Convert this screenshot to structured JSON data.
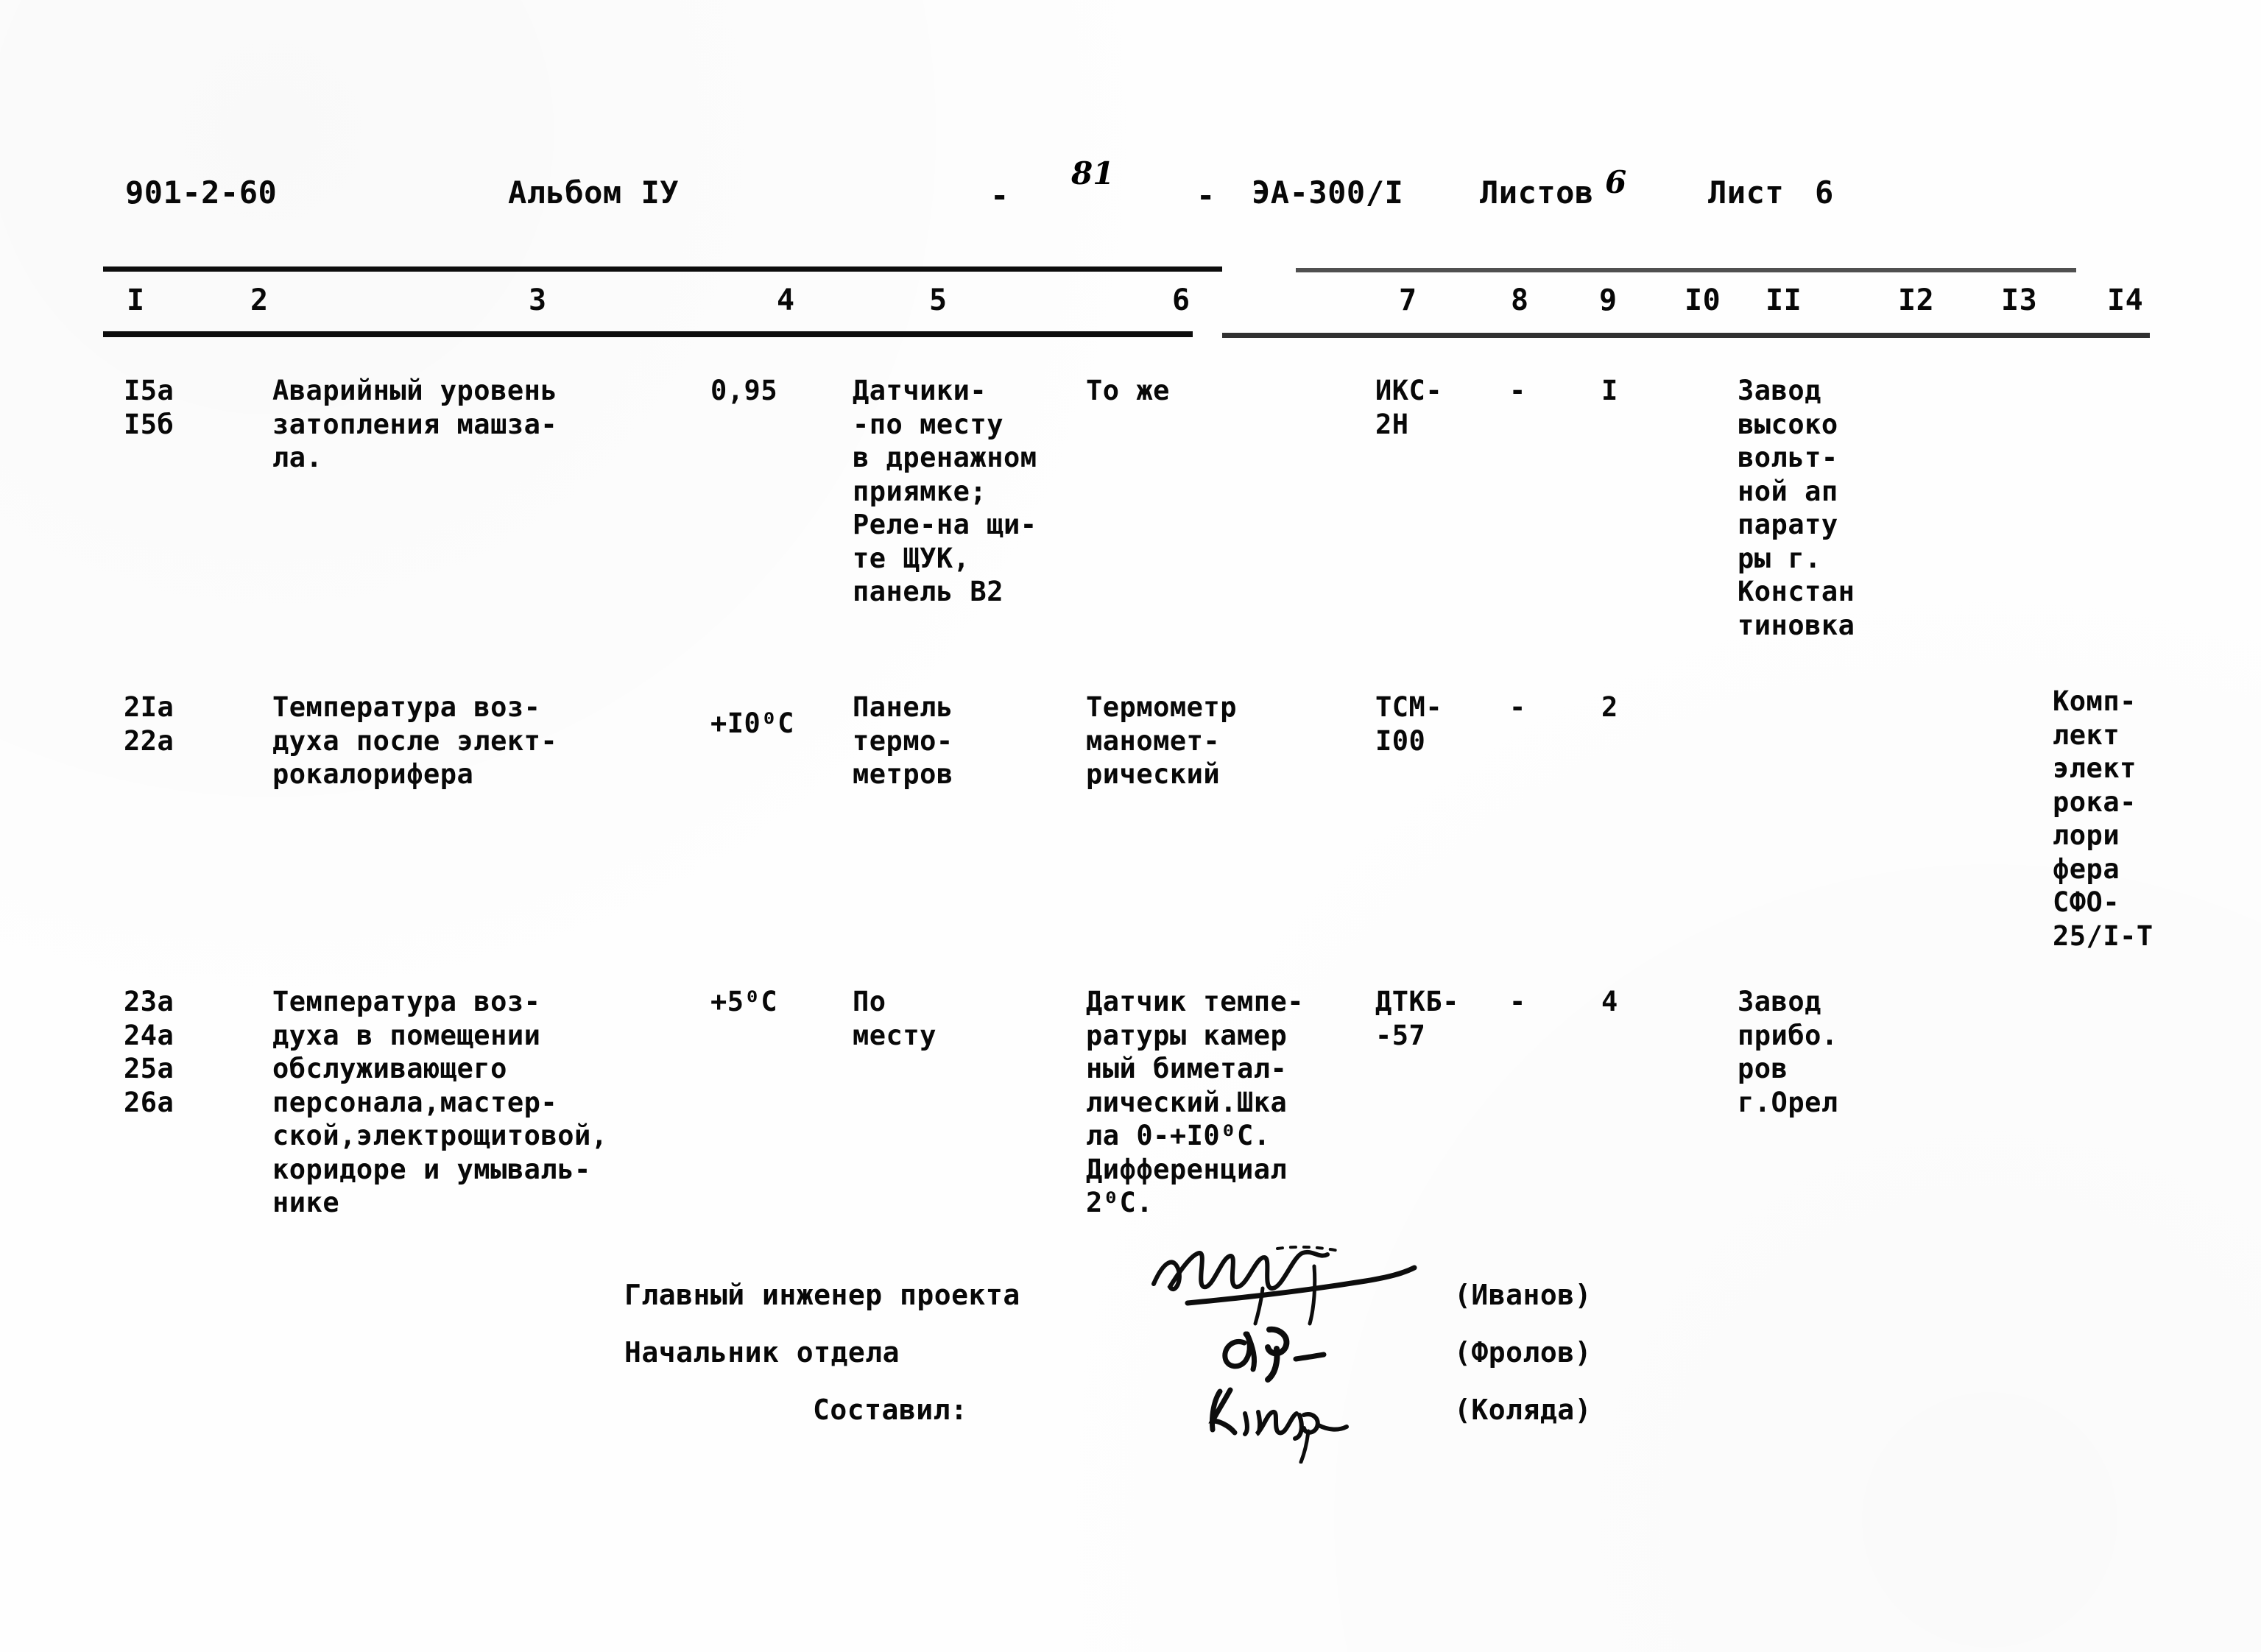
{
  "header": {
    "project_code": "901-2-60",
    "album": "Альбом IУ",
    "dash_left": "-",
    "page_number": "81",
    "dash_right": "-",
    "mark": "ЭА-300/I",
    "sheets_of_label": "Листов",
    "sheets_of_value": "6",
    "sheet_label": "Лист",
    "sheet_value": "6"
  },
  "table": {
    "column_numbers": [
      "I",
      "2",
      "3",
      "4",
      "5",
      "6",
      "7",
      "8",
      "9",
      "I0",
      "II",
      "I2",
      "I3",
      "I4"
    ],
    "rows": [
      {
        "col1": "I5а\nI5б",
        "col2": "Аварийный уровень\nзатопления машза-\nла.",
        "col4": "0,95",
        "col5": "Датчики-\n-по месту\nв дренажном\nприямке;\nРеле-на щи-\nте ЩУК,\nпанель В2",
        "col6": "То же",
        "col7": "ИКС-\n2Н",
        "col8": "-",
        "col9": "I",
        "col10": "Завод\nвысоко\nвольт-\nной ап\nпарату\nры г.\nКонстан\nтиновка",
        "col14": ""
      },
      {
        "col1": "2Iа\n22а",
        "col2": "Температура воз-\nдуха после элект-\nрокалорифера",
        "col4": "+I0⁰С",
        "col5": "Панель\nтермо-\nметров",
        "col6": "Термометр\nманомет-\nрический",
        "col7": "ТСМ-\nI00",
        "col8": "-",
        "col9": "2",
        "col10": "",
        "col14": "Комп-\nлект\nэлект\nрока-\nлори\nфера\nСФО-\n25/I-Т"
      },
      {
        "col1": "23а\n24а\n25а\n26а",
        "col2": "Температура воз-\nдуха в помещении\nобслуживающего\nперсонала,мастер-\nской,электрощитовой,\nкоридоре и умываль-\nнике",
        "col4": "+5⁰С",
        "col5": "По\nместу",
        "col6": "Датчик темпе-\nратуры камер\nный биметал-\nлический.Шка\nла 0-+I0⁰С.\nДифференциал\n2⁰С.",
        "col7": "ДТКБ-\n-57",
        "col8": "-",
        "col9": "4",
        "col10": "Завод\nприбо.\nров\nг.Орел",
        "col14": ""
      }
    ]
  },
  "signatures": [
    {
      "label": "Главный инженер проекта",
      "mark": "Е.Смирн",
      "name": "(Иванов)"
    },
    {
      "label": "Начальник отдела",
      "mark": "А.Ф.",
      "name": "(Фролов)"
    },
    {
      "label": "Составил:",
      "mark": "Коляда",
      "name": "(Коляда)"
    }
  ],
  "colors": {
    "ink": "#080808",
    "paper": "#fefefe"
  }
}
